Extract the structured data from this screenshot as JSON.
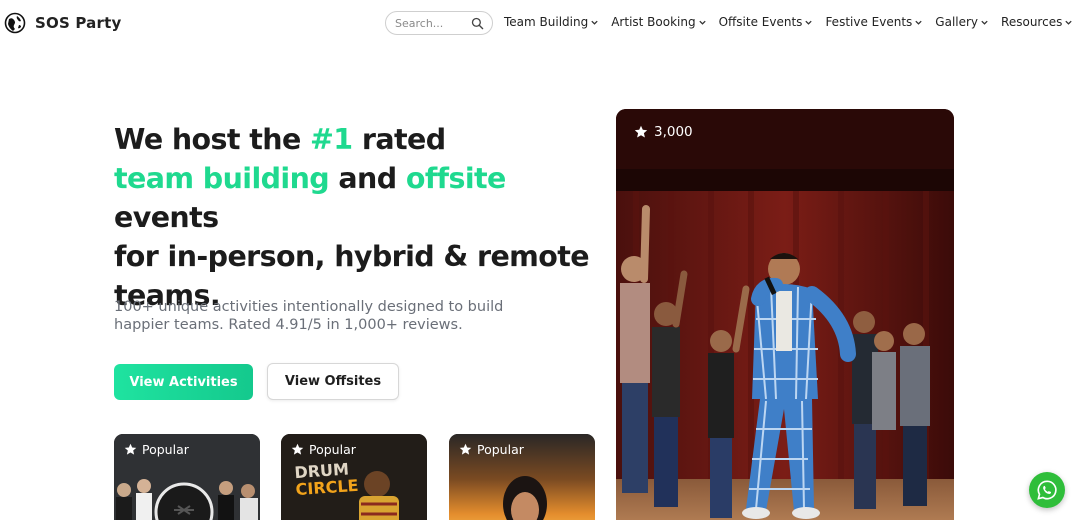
{
  "header": {
    "brand": "SOS Party",
    "search_placeholder": "Search...",
    "nav": [
      {
        "label": "Team Building"
      },
      {
        "label": "Artist Booking"
      },
      {
        "label": "Offsite Events"
      },
      {
        "label": "Festive Events"
      },
      {
        "label": "Gallery"
      },
      {
        "label": "Resources"
      }
    ]
  },
  "hero": {
    "title_part1": "We host the ",
    "title_accent1": "#1",
    "title_part2": " rated",
    "title_accent2": "team building",
    "title_part3": " and ",
    "title_accent3": "offsite",
    "title_part4": " events",
    "title_line3": "for in-person, hybrid & remote",
    "title_line4": "teams.",
    "subtitle": "100+ unique activities intentionally designed to build happier teams. Rated 4.91/5 in 1,000+ reviews.",
    "primary_button": "View Activities",
    "secondary_button": "View Offsites"
  },
  "cards": [
    {
      "badge": "Popular"
    },
    {
      "badge": "Popular",
      "image_text_1": "DRUM",
      "image_text_2": "CIRCLE"
    },
    {
      "badge": "Popular"
    }
  ],
  "hero_image": {
    "count": "3,000"
  },
  "colors": {
    "accent": "#1fd98f",
    "whatsapp": "#2fbe3a"
  },
  "icons": [
    "globe-logo-icon",
    "search-icon",
    "chevron-down-icon",
    "star-icon",
    "whatsapp-icon"
  ]
}
